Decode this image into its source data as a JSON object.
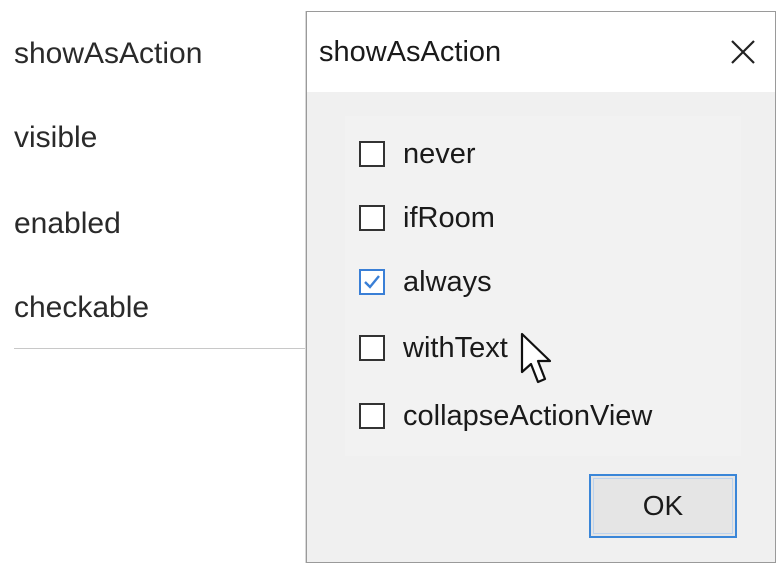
{
  "properties_panel": {
    "rows": [
      {
        "label": "showAsAction"
      },
      {
        "label": "visible"
      },
      {
        "label": "enabled"
      },
      {
        "label": "checkable"
      }
    ]
  },
  "dialog": {
    "title": "showAsAction",
    "close_icon": "close-icon",
    "options": [
      {
        "label": "never",
        "checked": false
      },
      {
        "label": "ifRoom",
        "checked": false
      },
      {
        "label": "always",
        "checked": true
      },
      {
        "label": "withText",
        "checked": false
      },
      {
        "label": "collapseActionView",
        "checked": false
      }
    ],
    "ok_label": "OK"
  },
  "colors": {
    "checked_accent": "#3a7fd6",
    "ok_border": "#3a86d8",
    "dialog_background": "#f0f0f0"
  }
}
